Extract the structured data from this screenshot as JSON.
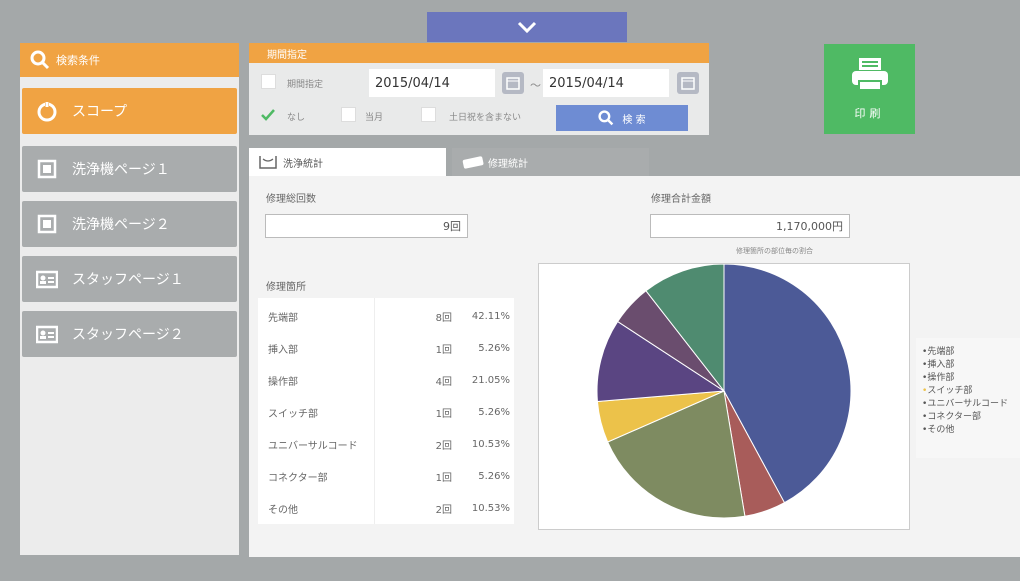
{
  "sidebar": {
    "header": "検索条件",
    "items": [
      {
        "label": "スコープ",
        "icon": "scope-icon",
        "active": true
      },
      {
        "label": "洗浄機ページ１",
        "icon": "page-icon",
        "active": false
      },
      {
        "label": "洗浄機ページ２",
        "icon": "page-icon",
        "active": false
      },
      {
        "label": "スタッフページ１",
        "icon": "staff-card-icon",
        "active": false
      },
      {
        "label": "スタッフページ２",
        "icon": "staff-card-icon",
        "active": false
      }
    ]
  },
  "period": {
    "header": "期間指定",
    "period_label": "期間指定",
    "date_from": "2015/04/14",
    "separator": "～",
    "date_to": "2015/04/14",
    "none_label": "なし",
    "month_label": "当月",
    "exclude_label": "土日祝を含まない",
    "search_label": "検 索"
  },
  "print": {
    "label": "印刷"
  },
  "tabs": {
    "wash": "洗浄統計",
    "repair": "修理統計"
  },
  "summary": {
    "count_label": "修理総回数",
    "count_value": "9回",
    "total_label": "修理合計金額",
    "total_value": "1,170,000円",
    "chart_caption": "修理箇所の部位毎の割合"
  },
  "parts": {
    "label": "修理箇所",
    "rows": [
      {
        "name": "先端部",
        "count": "8回",
        "pct": "42.11%"
      },
      {
        "name": "挿入部",
        "count": "1回",
        "pct": "5.26%"
      },
      {
        "name": "操作部",
        "count": "4回",
        "pct": "21.05%"
      },
      {
        "name": "スイッチ部",
        "count": "1回",
        "pct": "5.26%"
      },
      {
        "name": "ユニバーサルコード",
        "count": "2回",
        "pct": "10.53%"
      },
      {
        "name": "コネクター部",
        "count": "1回",
        "pct": "5.26%"
      },
      {
        "name": "その他",
        "count": "2回",
        "pct": "10.53%"
      }
    ]
  },
  "chart_data": {
    "type": "pie",
    "title": "修理箇所の部位毎の割合",
    "categories": [
      "先端部",
      "挿入部",
      "操作部",
      "スイッチ部",
      "ユニバーサルコード",
      "コネクター部",
      "その他"
    ],
    "values": [
      8,
      1,
      4,
      1,
      2,
      1,
      2
    ],
    "colors": [
      "#4c5a97",
      "#a85c5a",
      "#7e8b61",
      "#ecc24a",
      "#5a4582",
      "#6a4d6e",
      "#4f8b70"
    ],
    "legend_placement": "right"
  },
  "colors": {
    "accent": "#f0a343",
    "print": "#4fba64",
    "search": "#6e8cd3",
    "top_tab": "#6b76bd"
  }
}
